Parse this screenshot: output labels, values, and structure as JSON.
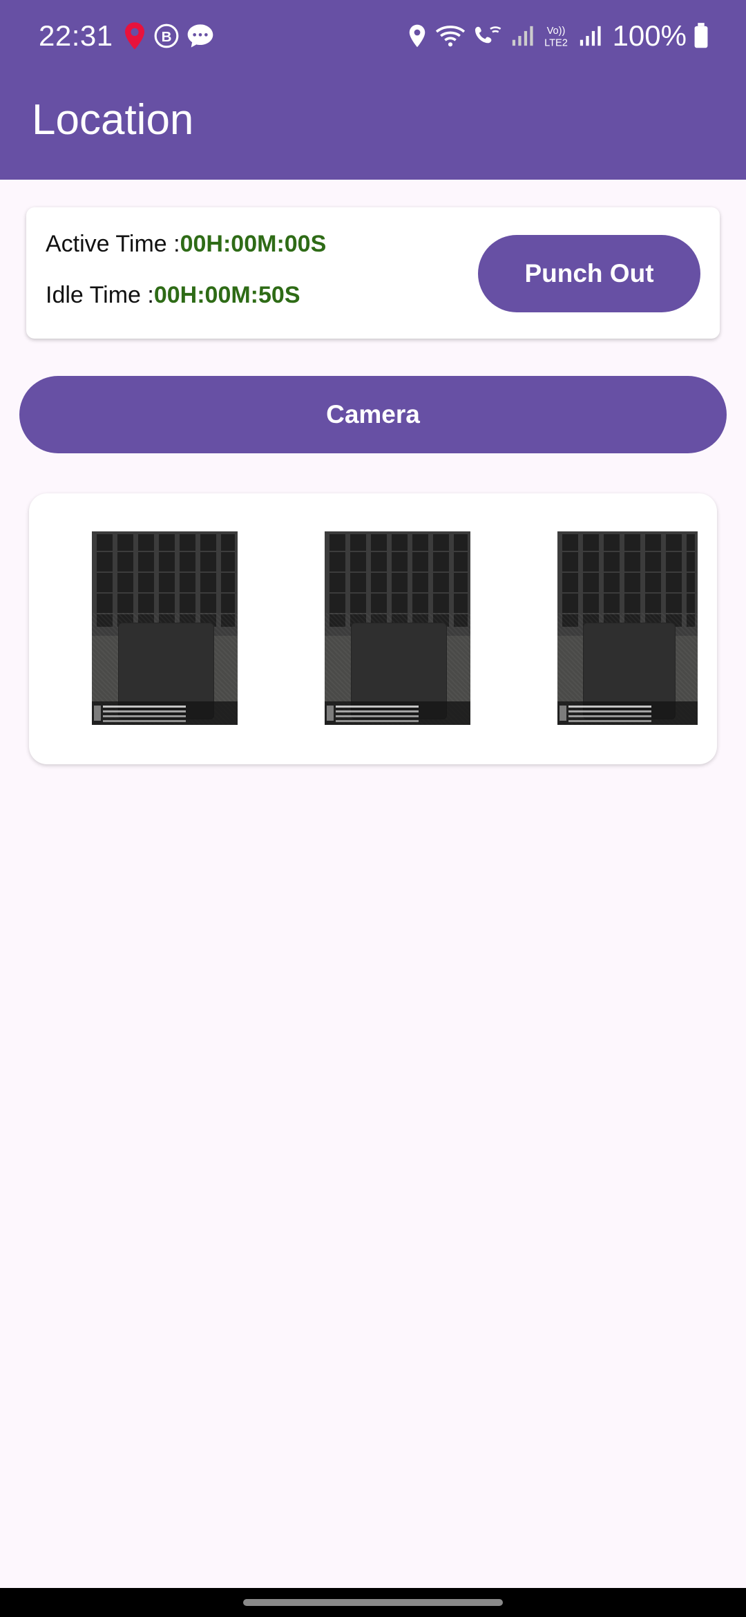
{
  "status_bar": {
    "time": "22:31",
    "battery": "100%",
    "left_icons": [
      "location-pin-icon",
      "b-badge-icon",
      "chat-bubble-icon"
    ],
    "right_icons": [
      "location-icon",
      "wifi-icon",
      "wifi-calling-icon",
      "signal-icon",
      "volte-icon",
      "signal-icon",
      "battery-icon"
    ],
    "volte_label": "Vo))\nLTE2"
  },
  "app_bar": {
    "title": "Location",
    "color": "#6750a4"
  },
  "timer_card": {
    "active_label": "Active Time :",
    "active_value": "00H:00M:00S",
    "idle_label": "Idle Time :",
    "idle_value": "00H:00M:50S",
    "value_color": "#2e6b16",
    "punch_out_label": "Punch Out"
  },
  "camera_button": {
    "label": "Camera"
  },
  "photos": {
    "items": [
      {
        "name": "photo-thumbnail-1"
      },
      {
        "name": "photo-thumbnail-2"
      },
      {
        "name": "photo-thumbnail-3"
      }
    ]
  }
}
